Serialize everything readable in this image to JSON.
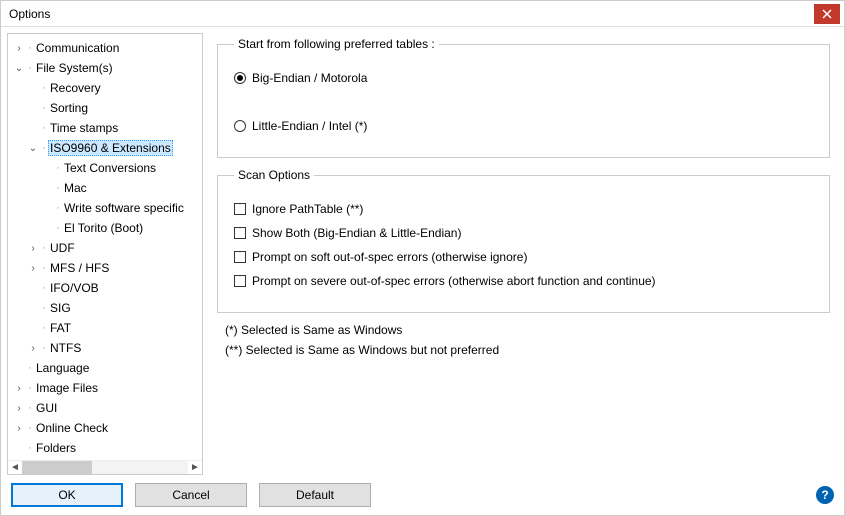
{
  "window": {
    "title": "Options"
  },
  "tree": {
    "items": [
      {
        "label": "Communication",
        "has_children": true,
        "expanded": false,
        "indent": 0
      },
      {
        "label": "File System(s)",
        "has_children": true,
        "expanded": true,
        "indent": 0
      },
      {
        "label": "Recovery",
        "has_children": false,
        "indent": 1
      },
      {
        "label": "Sorting",
        "has_children": false,
        "indent": 1
      },
      {
        "label": "Time stamps",
        "has_children": false,
        "indent": 1
      },
      {
        "label": "ISO9960 & Extensions",
        "has_children": true,
        "expanded": true,
        "indent": 1,
        "selected": true
      },
      {
        "label": "Text Conversions",
        "has_children": false,
        "indent": 2
      },
      {
        "label": "Mac",
        "has_children": false,
        "indent": 2
      },
      {
        "label": "Write software specific",
        "has_children": false,
        "indent": 2
      },
      {
        "label": "El Torito (Boot)",
        "has_children": false,
        "indent": 2
      },
      {
        "label": "UDF",
        "has_children": true,
        "expanded": false,
        "indent": 1
      },
      {
        "label": "MFS / HFS",
        "has_children": true,
        "expanded": false,
        "indent": 1
      },
      {
        "label": "IFO/VOB",
        "has_children": false,
        "indent": 1
      },
      {
        "label": "SIG",
        "has_children": false,
        "indent": 1
      },
      {
        "label": "FAT",
        "has_children": false,
        "indent": 1
      },
      {
        "label": "NTFS",
        "has_children": true,
        "expanded": false,
        "indent": 1
      },
      {
        "label": "Language",
        "has_children": false,
        "indent": 0
      },
      {
        "label": "Image Files",
        "has_children": true,
        "expanded": false,
        "indent": 0
      },
      {
        "label": "GUI",
        "has_children": true,
        "expanded": false,
        "indent": 0
      },
      {
        "label": "Online Check",
        "has_children": true,
        "expanded": false,
        "indent": 0
      },
      {
        "label": "Folders",
        "has_children": false,
        "indent": 0
      }
    ]
  },
  "panel": {
    "group1": {
      "legend": "Start from following preferred tables :",
      "radio_big": "Big-Endian / Motorola",
      "radio_little": "Little-Endian / Intel  (*)"
    },
    "group2": {
      "legend": "Scan Options",
      "chk_ignore": "Ignore PathTable  (**)",
      "chk_showboth": "Show Both (Big-Endian & Little-Endian)",
      "chk_soft": "Prompt on soft out-of-spec errors (otherwise ignore)",
      "chk_severe": "Prompt on severe out-of-spec errors (otherwise abort function and continue)"
    },
    "foot1": "(*)  Selected is Same as Windows",
    "foot2": "(**) Selected is Same as Windows but not preferred"
  },
  "buttons": {
    "ok": "OK",
    "cancel": "Cancel",
    "default": "Default"
  }
}
